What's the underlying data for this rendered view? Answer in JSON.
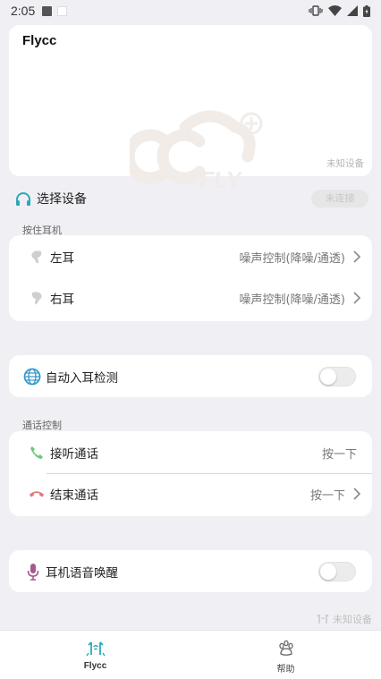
{
  "status_bar": {
    "time": "2:05"
  },
  "hero": {
    "brand": "Flycc",
    "device_status": "未知设备"
  },
  "select_device": {
    "label": "选择设备",
    "button": "未连接"
  },
  "press_section": {
    "label": "按住耳机",
    "items": [
      {
        "title": "左耳",
        "value": "噪声控制(降噪/通透)"
      },
      {
        "title": "右耳",
        "value": "噪声控制(降噪/通透)"
      }
    ]
  },
  "auto_detect": {
    "title": "自动入耳检测",
    "enabled": false
  },
  "call_section": {
    "label": "通话控制",
    "items": [
      {
        "title": "接听通话",
        "value": "按一下"
      },
      {
        "title": "结束通话",
        "value": "按一下"
      }
    ]
  },
  "voice_wake": {
    "title": "耳机语音唤醒",
    "enabled": false
  },
  "footer": {
    "device_status": "未知设备"
  },
  "nav": [
    {
      "label": "Flycc",
      "active": true
    },
    {
      "label": "帮助",
      "active": false
    }
  ],
  "colors": {
    "headphone": "#2aa9b8",
    "answer": "#66cc77",
    "hangup": "#e07a7a",
    "mic": "#a65a8c",
    "globe": "#3a9ac9"
  }
}
